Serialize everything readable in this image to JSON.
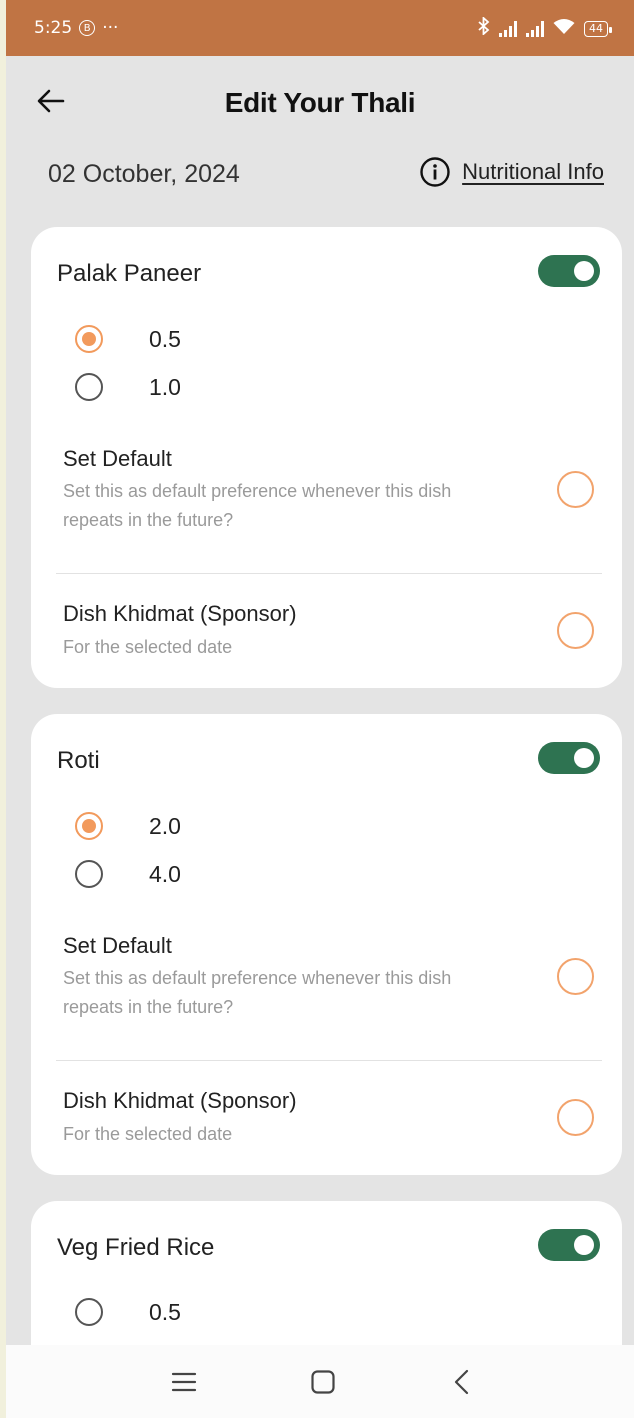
{
  "status_bar": {
    "time": "5:25",
    "badge": "B",
    "overflow": "···",
    "battery": "44",
    "icons": [
      "bluetooth-icon",
      "signal-icon",
      "signal-icon",
      "wifi-icon",
      "battery-icon"
    ]
  },
  "header": {
    "title": "Edit Your Thali",
    "back_icon": "arrow-left-icon"
  },
  "date_row": {
    "date": "02 October, 2024",
    "nutritional_info": "Nutritional Info",
    "info_icon": "info-circle-icon"
  },
  "dishes": [
    {
      "name": "Palak Paneer",
      "enabled": true,
      "options": [
        {
          "label": "0.5",
          "selected": true
        },
        {
          "label": "1.0",
          "selected": false
        }
      ],
      "set_default_title": "Set Default",
      "set_default_subtitle": "Set this as default preference whenever this dish repeats in the future?",
      "khidmat_title": "Dish Khidmat (Sponsor)",
      "khidmat_subtitle": "For the selected date"
    },
    {
      "name": "Roti",
      "enabled": true,
      "options": [
        {
          "label": "2.0",
          "selected": true
        },
        {
          "label": "4.0",
          "selected": false
        }
      ],
      "set_default_title": "Set Default",
      "set_default_subtitle": "Set this as default preference whenever this dish repeats in the future?",
      "khidmat_title": "Dish Khidmat (Sponsor)",
      "khidmat_subtitle": "For the selected date"
    },
    {
      "name": "Veg Fried Rice",
      "enabled": true,
      "options": [
        {
          "label": "0.5",
          "selected": false
        }
      ]
    }
  ],
  "nav_bar": {
    "icons": [
      "menu-icon",
      "home-square-icon",
      "back-chevron-icon"
    ]
  },
  "colors": {
    "status_bar": "#c07444",
    "toggle_on": "#2e7351",
    "radio_selected": "#f29a5c",
    "background": "#e4e4e4"
  }
}
